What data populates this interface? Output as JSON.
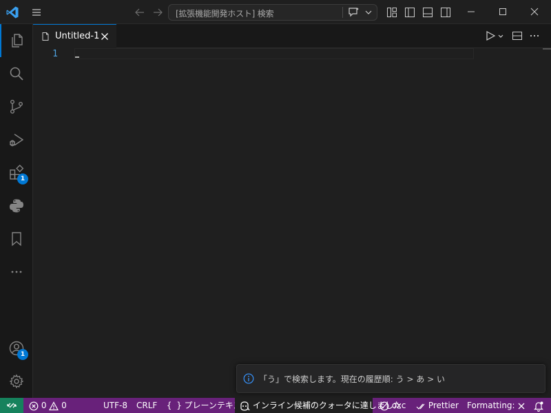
{
  "titlebar": {
    "search_text": "[拡張機能開発ホスト] 検索"
  },
  "activitybar": {
    "items": [
      {
        "name": "explorer"
      },
      {
        "name": "search"
      },
      {
        "name": "source-control"
      },
      {
        "name": "run-and-debug"
      },
      {
        "name": "extensions",
        "badge": "1"
      },
      {
        "name": "python"
      },
      {
        "name": "bookmarks"
      },
      {
        "name": "more"
      }
    ],
    "accounts_badge": "1"
  },
  "tabs": [
    {
      "label": "Untitled-1",
      "active": true
    }
  ],
  "editor": {
    "line_numbers": [
      "1"
    ]
  },
  "notification": {
    "message": "「う」で検索します。現在の履歴順: う > あ > い"
  },
  "statusbar": {
    "errors": "0",
    "warnings": "0",
    "encoding": "UTF-8",
    "eol": "CRLF",
    "language": "プレーンテキスト",
    "copilot": "インライン候補のクォータに達しました",
    "oxc": "oxc",
    "prettier": "Prettier",
    "formatting": "Formatting:",
    "bg_color": "#68217a"
  },
  "colors": {
    "accent": "#0078d4",
    "remote": "#16825d"
  }
}
